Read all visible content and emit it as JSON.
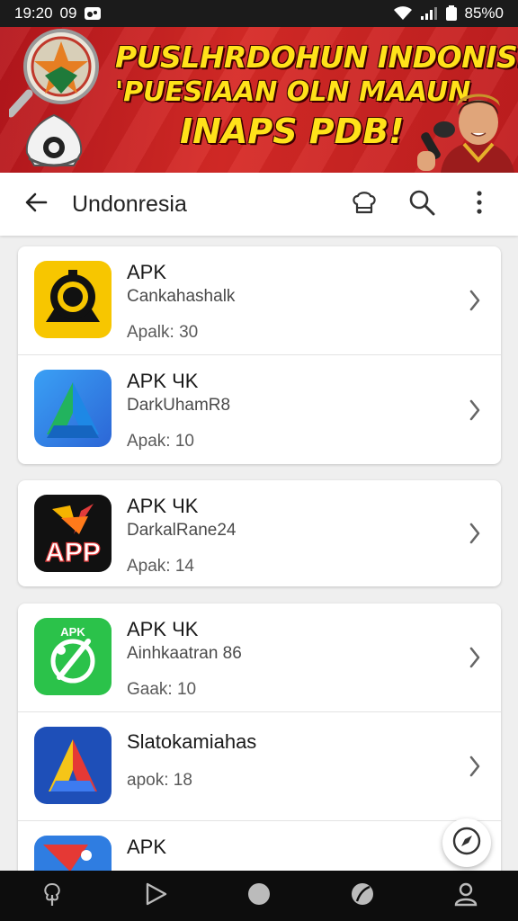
{
  "status_bar": {
    "time": "19:20",
    "left_text": "09",
    "battery": "85%0",
    "icons": [
      "cast-icon",
      "wifi-icon",
      "signal-icon",
      "battery-icon"
    ]
  },
  "banner": {
    "line1": "PUSLHRDOHUN INDONISIA",
    "line2": "'PUESIAAN OLN MAAUN",
    "line3": "INAPS PDB!"
  },
  "app_bar": {
    "title": "Undonresia",
    "icons": [
      "back-arrow-icon",
      "chef-hat-icon",
      "search-icon",
      "more-vert-icon"
    ]
  },
  "cards": [
    {
      "rows": [
        {
          "title": "APK",
          "subtitle": "Cankahashalk",
          "meta": "Apalk: 30",
          "icon": "yellow-wheel-app-icon"
        },
        {
          "title": "APK ЧK",
          "subtitle": "DarkUhamR8",
          "meta": "Apak: 10",
          "icon": "blue-green-a-app-icon"
        }
      ]
    },
    {
      "rows": [
        {
          "title": "APK ЧK",
          "subtitle": "DarkalRane24",
          "meta": "Apak: 14",
          "icon": "black-app-app-icon",
          "icon_text": "APP"
        }
      ]
    },
    {
      "rows": [
        {
          "title": "APK ЧK",
          "subtitle": "Ainhkaatran 86",
          "meta": "Gaak: 10",
          "icon": "green-apk-app-icon",
          "icon_text": "APK"
        },
        {
          "title": "Slatokamiahas",
          "subtitle": "",
          "meta": "apok: 18",
          "icon": "blue-a-app-icon"
        },
        {
          "title": "APK",
          "subtitle": "",
          "meta": "",
          "icon": "red-app-icon"
        }
      ]
    }
  ],
  "fab": {
    "icon": "compass-icon"
  },
  "bottom_nav": {
    "icons": [
      "tree-icon",
      "play-icon",
      "home-circle-icon",
      "leaf-icon",
      "profile-icon"
    ]
  },
  "colors": {
    "banner_red": "#d72a26",
    "banner_text": "#ffe21a",
    "background": "#efefef"
  }
}
